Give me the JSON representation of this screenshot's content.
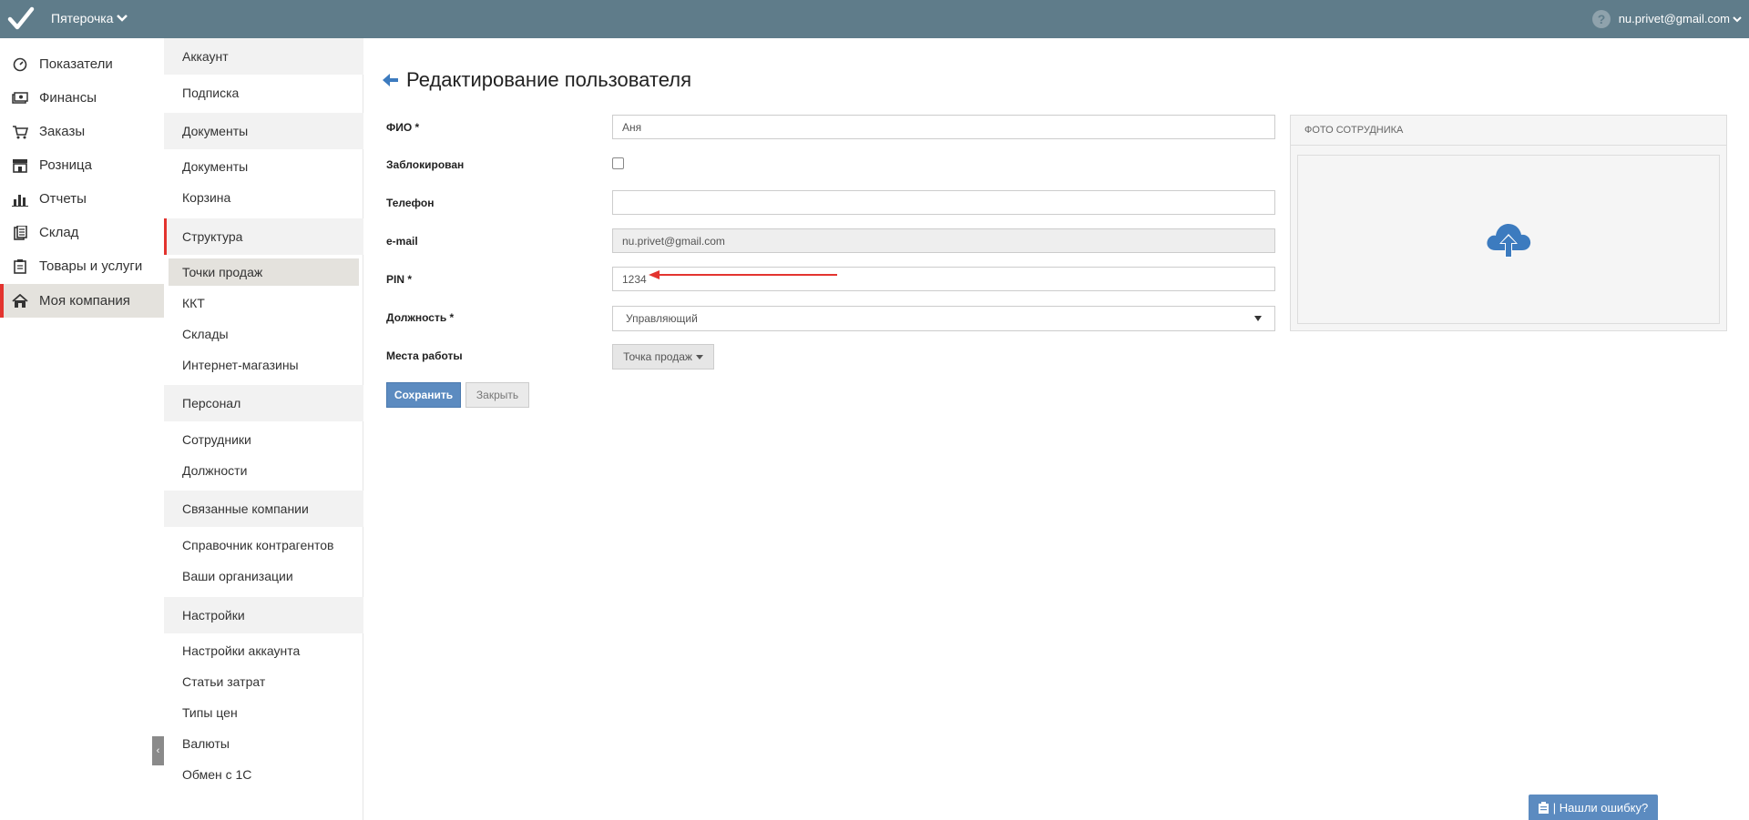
{
  "header": {
    "company": "Пятерочка",
    "help": "?",
    "user": "nu.privet@gmail.com"
  },
  "leftnav": [
    {
      "label": "Показатели",
      "icon": "dashboard-icon"
    },
    {
      "label": "Финансы",
      "icon": "money-icon"
    },
    {
      "label": "Заказы",
      "icon": "cart-icon"
    },
    {
      "label": "Розница",
      "icon": "store-icon"
    },
    {
      "label": "Отчеты",
      "icon": "bar-chart-icon"
    },
    {
      "label": "Склад",
      "icon": "warehouse-icon"
    },
    {
      "label": "Товары и услуги",
      "icon": "clipboard-icon"
    },
    {
      "label": "Моя компания",
      "icon": "home-icon",
      "active": true
    }
  ],
  "subnav": {
    "account_head": "Аккаунт",
    "subscription": "Подписка",
    "documents_head": "Документы",
    "documents": "Документы",
    "basket": "Корзина",
    "structure_head": "Структура",
    "points_of_sale": "Точки продаж",
    "kkt": "ККТ",
    "warehouses": "Склады",
    "online_stores": "Интернет-магазины",
    "staff_head": "Персонал",
    "employees": "Сотрудники",
    "positions": "Должности",
    "related_head": "Связанные компании",
    "counterparties": "Справочник контрагентов",
    "organizations": "Ваши организации",
    "settings_head": "Настройки",
    "account_settings": "Настройки аккаунта",
    "expense_items": "Статьи затрат",
    "price_types": "Типы цен",
    "currencies": "Валюты",
    "exchange_1c": "Обмен с 1С",
    "collapse": "‹"
  },
  "form": {
    "title": "Редактирование пользователя",
    "name_label": "ФИО *",
    "name_value": "Аня",
    "blocked_label": "Заблокирован",
    "phone_label": "Телефон",
    "phone_value": "",
    "email_label": "e-mail",
    "email_value": "nu.privet@gmail.com",
    "pin_label": "PIN *",
    "pin_value": "1234",
    "position_label": "Должность *",
    "position_value": "Управляющий",
    "workplaces_label": "Места работы",
    "workplaces_value": "Точка продаж",
    "save_label": "Сохранить",
    "close_label": "Закрыть"
  },
  "photo": {
    "heading": "ФОТО СОТРУДНИКА"
  },
  "bug_report": "| Нашли ошибку?",
  "colors": {
    "topbar": "#5f7c8a",
    "accent_red": "#e3342f",
    "primary_blue": "#5c8bc0",
    "upload_icon": "#3c7bbf"
  }
}
